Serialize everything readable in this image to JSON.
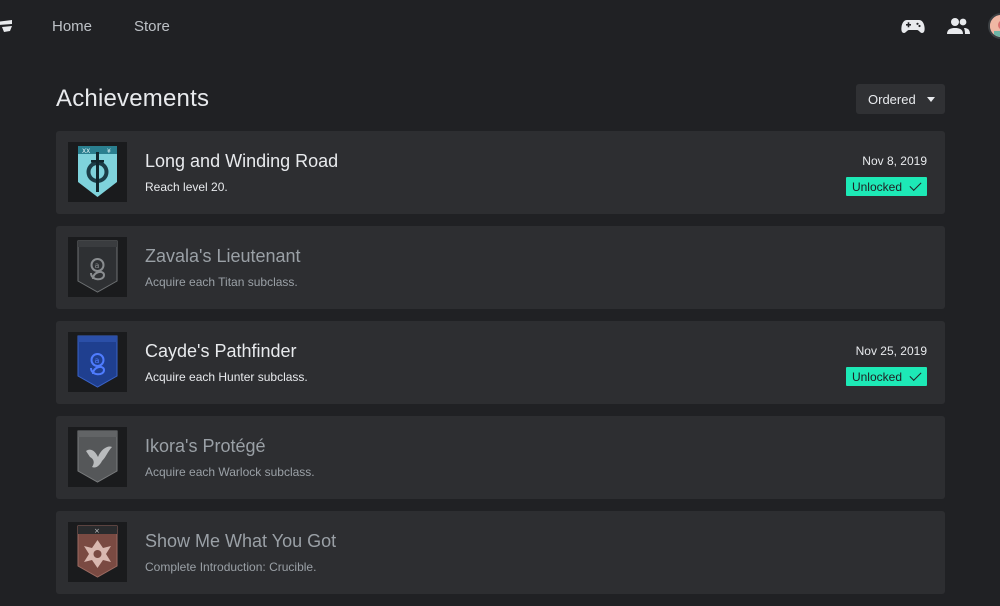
{
  "nav": {
    "home": "Home",
    "store": "Store"
  },
  "icons": {
    "logo": "stadia-logo-icon",
    "controller": "gamepad-icon",
    "friends": "people-icon",
    "avatar": "user-avatar"
  },
  "page": {
    "title": "Achievements",
    "sort_label": "Ordered"
  },
  "colors": {
    "background": "#202124",
    "card": "#2d2e31",
    "unlocked_tag": "#1de9b6"
  },
  "achievements": [
    {
      "name": "Long and Winding Road",
      "description": "Reach level 20.",
      "date": "Nov 8, 2019",
      "status": "Unlocked",
      "unlocked": true,
      "badge_icon": "sword-emblem-icon",
      "badge_color": "#7fd3dc"
    },
    {
      "name": "Zavala's Lieutenant",
      "description": "Acquire each Titan subclass.",
      "date": "",
      "status": "",
      "unlocked": false,
      "badge_icon": "serpent-emblem-icon",
      "badge_color": "#2e3033"
    },
    {
      "name": "Cayde's Pathfinder",
      "description": "Acquire each Hunter subclass.",
      "date": "Nov 25, 2019",
      "status": "Unlocked",
      "unlocked": true,
      "badge_icon": "serpent-emblem-icon",
      "badge_color": "#1f3f8f"
    },
    {
      "name": "Ikora's Protégé",
      "description": "Acquire each Warlock subclass.",
      "date": "",
      "status": "",
      "unlocked": false,
      "badge_icon": "bird-emblem-icon",
      "badge_color": "#555759"
    },
    {
      "name": "Show Me What You Got",
      "description": "Complete Introduction: Crucible.",
      "date": "",
      "status": "",
      "unlocked": false,
      "badge_icon": "crucible-emblem-icon",
      "badge_color": "#7a4a42"
    }
  ]
}
